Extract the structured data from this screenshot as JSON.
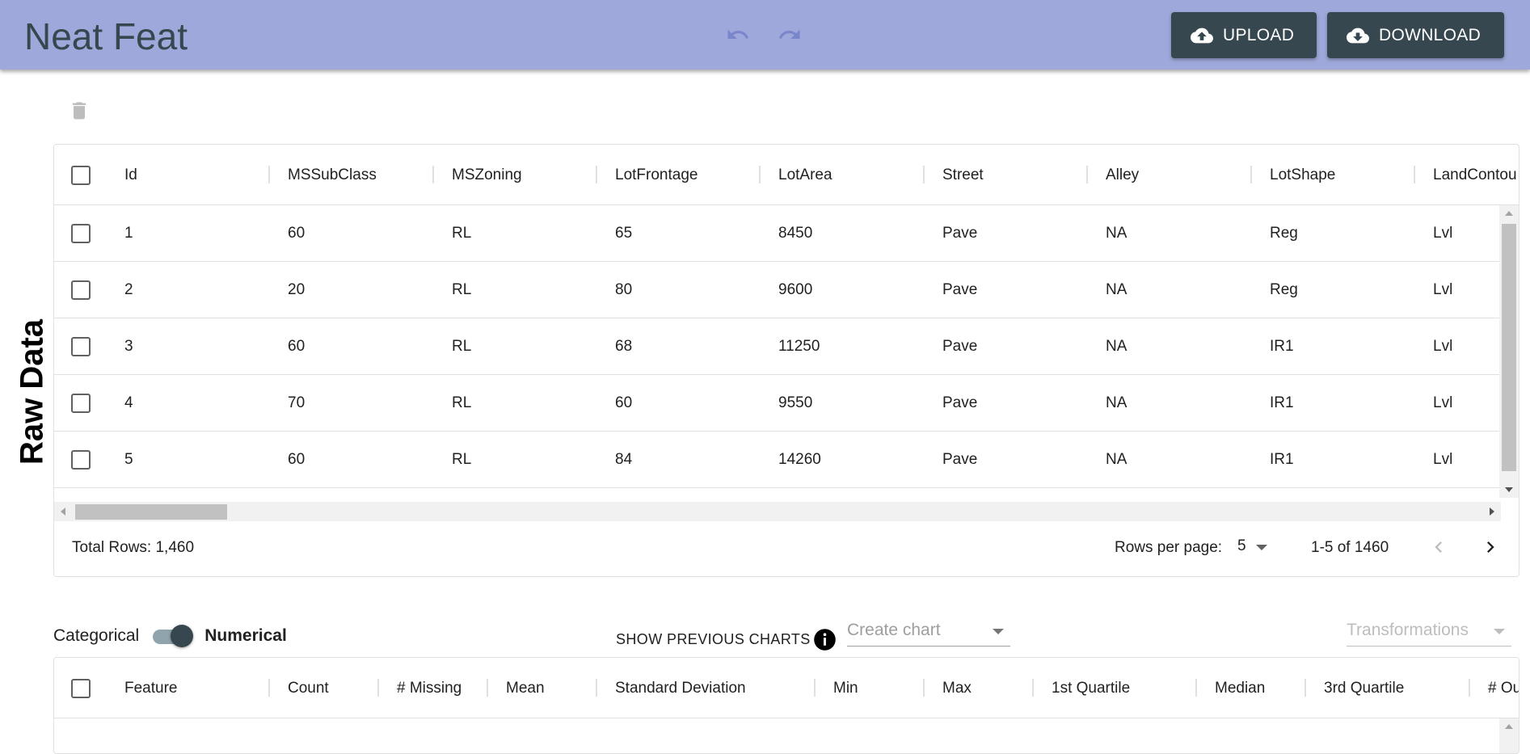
{
  "app": {
    "title": "Neat Feat",
    "upload_label": "UPLOAD",
    "download_label": "DOWNLOAD"
  },
  "raw_data": {
    "section_label": "Raw Data",
    "columns": [
      "Id",
      "MSSubClass",
      "MSZoning",
      "LotFrontage",
      "LotArea",
      "Street",
      "Alley",
      "LotShape",
      "LandContou"
    ],
    "rows": [
      [
        "1",
        "60",
        "RL",
        "65",
        "8450",
        "Pave",
        "NA",
        "Reg",
        "Lvl"
      ],
      [
        "2",
        "20",
        "RL",
        "80",
        "9600",
        "Pave",
        "NA",
        "Reg",
        "Lvl"
      ],
      [
        "3",
        "60",
        "RL",
        "68",
        "11250",
        "Pave",
        "NA",
        "IR1",
        "Lvl"
      ],
      [
        "4",
        "70",
        "RL",
        "60",
        "9550",
        "Pave",
        "NA",
        "IR1",
        "Lvl"
      ],
      [
        "5",
        "60",
        "RL",
        "84",
        "14260",
        "Pave",
        "NA",
        "IR1",
        "Lvl"
      ]
    ],
    "footer": {
      "total_rows": "Total Rows: 1,460",
      "rows_per_page_label": "Rows per page:",
      "rows_per_page_value": "5",
      "range": "1-5 of 1460"
    }
  },
  "controls": {
    "categorical_label": "Categorical",
    "numerical_label": "Numerical",
    "toggle_state": "numerical",
    "show_previous_charts": "SHOW PREVIOUS CHARTS",
    "create_chart_placeholder": "Create chart",
    "transformations_placeholder": "Transformations"
  },
  "stats": {
    "columns": [
      "Feature",
      "Count",
      "# Missing",
      "Mean",
      "Standard Deviation",
      "Min",
      "Max",
      "1st Quartile",
      "Median",
      "3rd Quartile",
      "# Ou"
    ]
  },
  "colors": {
    "appbar": "#9fa8da",
    "button": "#37474f",
    "title": "#37474f"
  },
  "icons": [
    "undo-icon",
    "redo-icon",
    "cloud-upload-icon",
    "cloud-download-icon",
    "trash-icon",
    "info-icon",
    "chevron-left-icon",
    "chevron-right-icon",
    "caret-down-icon"
  ]
}
